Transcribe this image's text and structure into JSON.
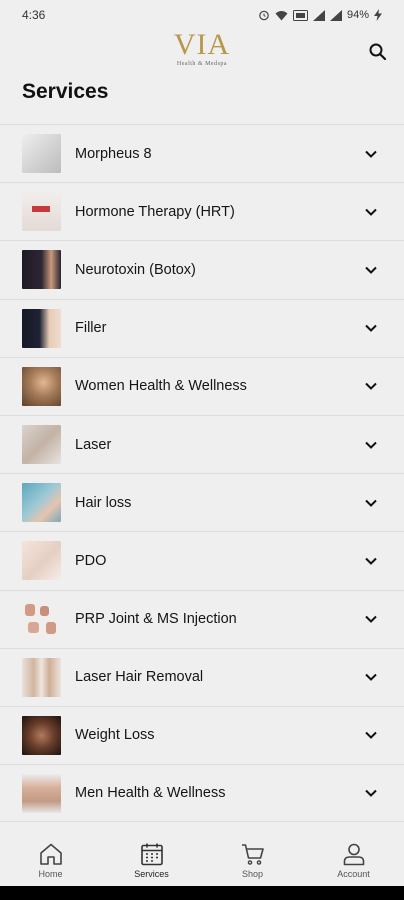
{
  "status_bar": {
    "time": "4:36",
    "battery": "94%"
  },
  "header": {
    "logo_text": "VIA",
    "logo_subtext": "Health & Medspa",
    "search_icon": "search-icon"
  },
  "page": {
    "title": "Services"
  },
  "services": [
    {
      "label": "Morpheus 8",
      "thumb_color": "#d9d9d9"
    },
    {
      "label": "Hormone Therapy (HRT)",
      "thumb_color": "#e8e1df"
    },
    {
      "label": "Neurotoxin (Botox)",
      "thumb_color": "#2a2430"
    },
    {
      "label": "Filler",
      "thumb_color": "#1a1e2c"
    },
    {
      "label": "Women Health & Wellness",
      "thumb_color": "#8c6a4c"
    },
    {
      "label": "Laser",
      "thumb_color": "#c9c3bd"
    },
    {
      "label": "Hair loss",
      "thumb_color": "#7ab6c9"
    },
    {
      "label": "PDO",
      "thumb_color": "#e6d5cf"
    },
    {
      "label": "PRP Joint & MS Injection",
      "thumb_color": "#e7e2de"
    },
    {
      "label": "Laser Hair Removal",
      "thumb_color": "#d8cfc6"
    },
    {
      "label": "Weight Loss",
      "thumb_color": "#4a2f24"
    },
    {
      "label": "Men Health & Wellness",
      "thumb_color": "#c7a18a"
    }
  ],
  "bottom_nav": {
    "home": "Home",
    "services": "Services",
    "shop": "Shop",
    "account": "Account"
  }
}
